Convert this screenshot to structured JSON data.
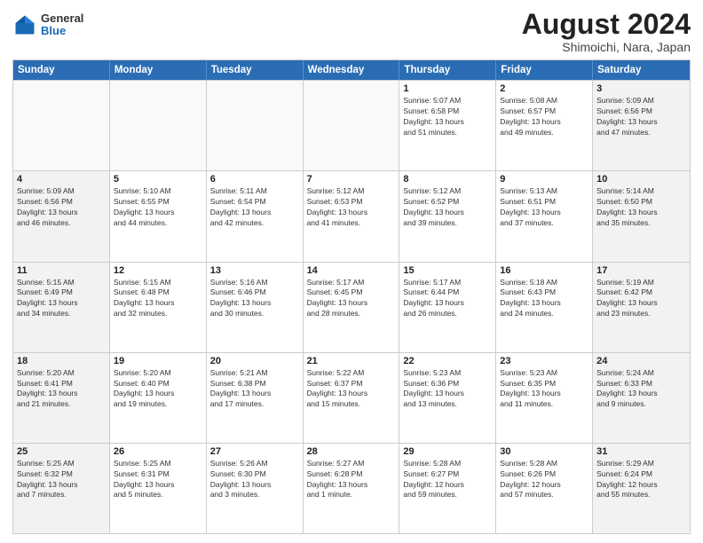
{
  "header": {
    "logo": {
      "general": "General",
      "blue": "Blue"
    },
    "title": "August 2024",
    "subtitle": "Shimoichi, Nara, Japan"
  },
  "calendar": {
    "weekdays": [
      "Sunday",
      "Monday",
      "Tuesday",
      "Wednesday",
      "Thursday",
      "Friday",
      "Saturday"
    ],
    "weeks": [
      [
        {
          "day": "",
          "info": "",
          "empty": true
        },
        {
          "day": "",
          "info": "",
          "empty": true
        },
        {
          "day": "",
          "info": "",
          "empty": true
        },
        {
          "day": "",
          "info": "",
          "empty": true
        },
        {
          "day": "1",
          "info": "Sunrise: 5:07 AM\nSunset: 6:58 PM\nDaylight: 13 hours\nand 51 minutes."
        },
        {
          "day": "2",
          "info": "Sunrise: 5:08 AM\nSunset: 6:57 PM\nDaylight: 13 hours\nand 49 minutes."
        },
        {
          "day": "3",
          "info": "Sunrise: 5:09 AM\nSunset: 6:56 PM\nDaylight: 13 hours\nand 47 minutes."
        }
      ],
      [
        {
          "day": "4",
          "info": "Sunrise: 5:09 AM\nSunset: 6:56 PM\nDaylight: 13 hours\nand 46 minutes."
        },
        {
          "day": "5",
          "info": "Sunrise: 5:10 AM\nSunset: 6:55 PM\nDaylight: 13 hours\nand 44 minutes."
        },
        {
          "day": "6",
          "info": "Sunrise: 5:11 AM\nSunset: 6:54 PM\nDaylight: 13 hours\nand 42 minutes."
        },
        {
          "day": "7",
          "info": "Sunrise: 5:12 AM\nSunset: 6:53 PM\nDaylight: 13 hours\nand 41 minutes."
        },
        {
          "day": "8",
          "info": "Sunrise: 5:12 AM\nSunset: 6:52 PM\nDaylight: 13 hours\nand 39 minutes."
        },
        {
          "day": "9",
          "info": "Sunrise: 5:13 AM\nSunset: 6:51 PM\nDaylight: 13 hours\nand 37 minutes."
        },
        {
          "day": "10",
          "info": "Sunrise: 5:14 AM\nSunset: 6:50 PM\nDaylight: 13 hours\nand 35 minutes."
        }
      ],
      [
        {
          "day": "11",
          "info": "Sunrise: 5:15 AM\nSunset: 6:49 PM\nDaylight: 13 hours\nand 34 minutes."
        },
        {
          "day": "12",
          "info": "Sunrise: 5:15 AM\nSunset: 6:48 PM\nDaylight: 13 hours\nand 32 minutes."
        },
        {
          "day": "13",
          "info": "Sunrise: 5:16 AM\nSunset: 6:46 PM\nDaylight: 13 hours\nand 30 minutes."
        },
        {
          "day": "14",
          "info": "Sunrise: 5:17 AM\nSunset: 6:45 PM\nDaylight: 13 hours\nand 28 minutes."
        },
        {
          "day": "15",
          "info": "Sunrise: 5:17 AM\nSunset: 6:44 PM\nDaylight: 13 hours\nand 26 minutes."
        },
        {
          "day": "16",
          "info": "Sunrise: 5:18 AM\nSunset: 6:43 PM\nDaylight: 13 hours\nand 24 minutes."
        },
        {
          "day": "17",
          "info": "Sunrise: 5:19 AM\nSunset: 6:42 PM\nDaylight: 13 hours\nand 23 minutes."
        }
      ],
      [
        {
          "day": "18",
          "info": "Sunrise: 5:20 AM\nSunset: 6:41 PM\nDaylight: 13 hours\nand 21 minutes."
        },
        {
          "day": "19",
          "info": "Sunrise: 5:20 AM\nSunset: 6:40 PM\nDaylight: 13 hours\nand 19 minutes."
        },
        {
          "day": "20",
          "info": "Sunrise: 5:21 AM\nSunset: 6:38 PM\nDaylight: 13 hours\nand 17 minutes."
        },
        {
          "day": "21",
          "info": "Sunrise: 5:22 AM\nSunset: 6:37 PM\nDaylight: 13 hours\nand 15 minutes."
        },
        {
          "day": "22",
          "info": "Sunrise: 5:23 AM\nSunset: 6:36 PM\nDaylight: 13 hours\nand 13 minutes."
        },
        {
          "day": "23",
          "info": "Sunrise: 5:23 AM\nSunset: 6:35 PM\nDaylight: 13 hours\nand 11 minutes."
        },
        {
          "day": "24",
          "info": "Sunrise: 5:24 AM\nSunset: 6:33 PM\nDaylight: 13 hours\nand 9 minutes."
        }
      ],
      [
        {
          "day": "25",
          "info": "Sunrise: 5:25 AM\nSunset: 6:32 PM\nDaylight: 13 hours\nand 7 minutes."
        },
        {
          "day": "26",
          "info": "Sunrise: 5:25 AM\nSunset: 6:31 PM\nDaylight: 13 hours\nand 5 minutes."
        },
        {
          "day": "27",
          "info": "Sunrise: 5:26 AM\nSunset: 6:30 PM\nDaylight: 13 hours\nand 3 minutes."
        },
        {
          "day": "28",
          "info": "Sunrise: 5:27 AM\nSunset: 6:28 PM\nDaylight: 13 hours\nand 1 minute."
        },
        {
          "day": "29",
          "info": "Sunrise: 5:28 AM\nSunset: 6:27 PM\nDaylight: 12 hours\nand 59 minutes."
        },
        {
          "day": "30",
          "info": "Sunrise: 5:28 AM\nSunset: 6:26 PM\nDaylight: 12 hours\nand 57 minutes."
        },
        {
          "day": "31",
          "info": "Sunrise: 5:29 AM\nSunset: 6:24 PM\nDaylight: 12 hours\nand 55 minutes."
        }
      ]
    ]
  }
}
